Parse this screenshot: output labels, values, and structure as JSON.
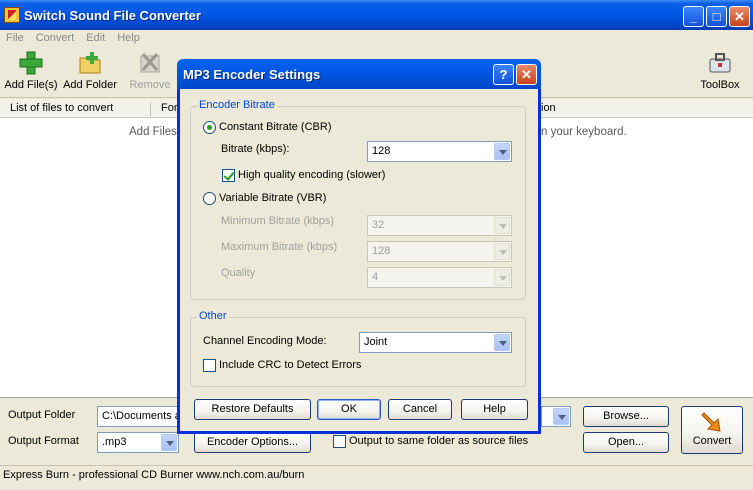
{
  "window": {
    "title": "Switch Sound File Converter",
    "minimize_glyph": "_",
    "maximize_glyph": "□",
    "close_glyph": "✕"
  },
  "menu": [
    "File",
    "Convert",
    "Edit",
    "Help"
  ],
  "toolbar": {
    "add_files": "Add File(s)",
    "add_folder": "Add Folder",
    "remove": "Remove",
    "toolbox": "ToolBox"
  },
  "list": {
    "header_name": "List of files to convert",
    "header_format": "For",
    "header_location": "ion",
    "hint_left": "Add Files",
    "hint_right": "n your keyboard."
  },
  "bottom": {
    "output_folder_label": "Output Folder",
    "output_folder_value": "C:\\Documents a",
    "output_format_label": "Output Format",
    "output_format_value": ".mp3",
    "encoder_options": "Encoder Options...",
    "same_folder_label": "Output to same folder as source files",
    "same_folder_checked": false,
    "browse": "Browse...",
    "open": "Open...",
    "convert": "Convert"
  },
  "status": "Express Burn - professional CD Burner www.nch.com.au/burn",
  "dialog": {
    "title": "MP3 Encoder Settings",
    "help_glyph": "?",
    "close_glyph": "✕",
    "encoder_bitrate_group": "Encoder Bitrate",
    "cbr_label": "Constant Bitrate (CBR)",
    "cbr_selected": true,
    "bitrate_label": "Bitrate (kbps):",
    "bitrate_value": "128",
    "hq_label": "High quality encoding (slower)",
    "hq_checked": true,
    "vbr_label": "Variable Bitrate (VBR)",
    "vbr_selected": false,
    "min_bitrate_label": "Minimum Bitrate (kbps)",
    "min_bitrate_value": "32",
    "max_bitrate_label": "Maximum Bitrate (kbps)",
    "max_bitrate_value": "128",
    "quality_label": "Quality",
    "quality_value": "4",
    "other_group": "Other",
    "channel_mode_label": "Channel Encoding Mode:",
    "channel_mode_value": "Joint",
    "crc_label": "Include CRC to Detect Errors",
    "crc_checked": false,
    "restore_defaults": "Restore Defaults",
    "ok": "OK",
    "cancel": "Cancel",
    "help": "Help"
  }
}
